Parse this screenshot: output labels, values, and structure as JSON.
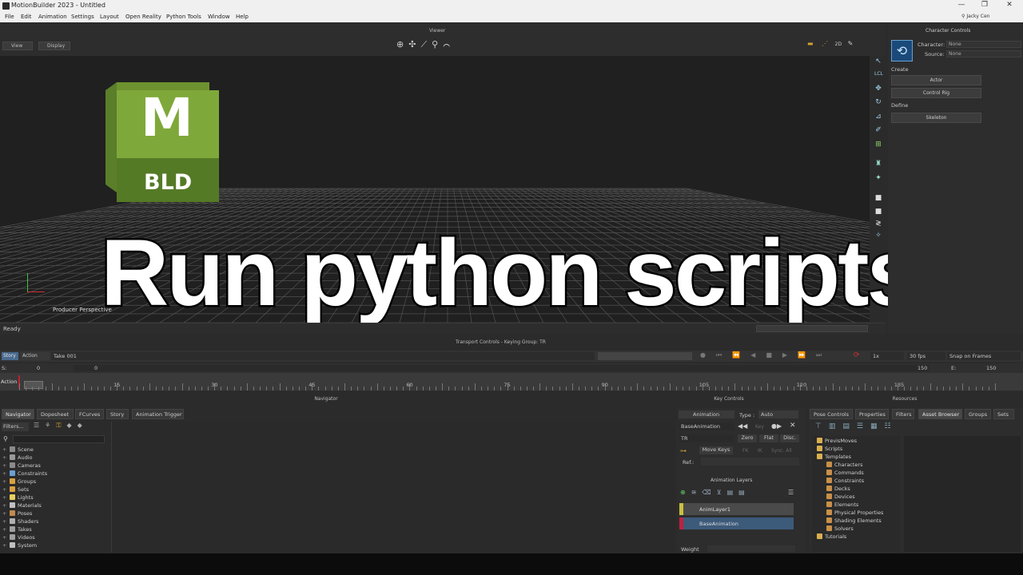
{
  "window": {
    "title": "MotionBuilder 2023 - Untitled",
    "user": "Jacky Cen",
    "controls": [
      "—",
      "❐",
      "✕"
    ]
  },
  "menu": [
    "File",
    "Edit",
    "Animation",
    "Settings",
    "Layout",
    "Open Reality",
    "Python Tools",
    "Window",
    "Help"
  ],
  "viewer": {
    "title": "Viewer",
    "view_btn": "View",
    "display_btn": "Display",
    "camera_label": "Producer Perspective",
    "mode_2d": "2D"
  },
  "logo": {
    "letter": "M",
    "label": "BLD",
    "color_front": "#7fa83a",
    "color_side": "#5a7e2a"
  },
  "headline": "Run python scripts",
  "status": "Ready",
  "character_controls": {
    "title": "Character Controls",
    "character_label": "Character:",
    "character_value": "None",
    "source_label": "Source:",
    "source_value": "None",
    "create_label": "Create",
    "actor_btn": "Actor",
    "control_rig_btn": "Control Rig",
    "define_label": "Define",
    "skeleton_btn": "Skeleton"
  },
  "transport": {
    "title": "Transport Controls  -  Keying Group: TR",
    "story_btn": "Story",
    "action_btn": "Action",
    "take": "Take 001",
    "speed": "1x",
    "fps": "30 fps",
    "snap": "Snap on Frames",
    "start_label": "S:",
    "start_value": "0",
    "current_value": "0",
    "end_value": "150",
    "end_label": "E:",
    "end_value2": "150",
    "track_label": "Action",
    "ruler_labels": [
      "15",
      "30",
      "45",
      "60",
      "75",
      "90",
      "105",
      "120",
      "135"
    ]
  },
  "navigator": {
    "title": "Navigator",
    "tabs": [
      "Navigator",
      "Dopesheet",
      "FCurves",
      "Story",
      "Animation Trigger"
    ],
    "filters": "Filters...",
    "tree": [
      {
        "label": "Scene",
        "color": "#8a8a8a"
      },
      {
        "label": "Audio",
        "color": "#9a9a9a"
      },
      {
        "label": "Cameras",
        "color": "#8a8a8a"
      },
      {
        "label": "Constraints",
        "color": "#6aa0d0"
      },
      {
        "label": "Groups",
        "color": "#d8a040"
      },
      {
        "label": "Sets",
        "color": "#d8a040"
      },
      {
        "label": "Lights",
        "color": "#e8d060"
      },
      {
        "label": "Materials",
        "color": "#c0c0c0"
      },
      {
        "label": "Poses",
        "color": "#c08a50"
      },
      {
        "label": "Shaders",
        "color": "#b0b0b0"
      },
      {
        "label": "Takes",
        "color": "#a0a0a0"
      },
      {
        "label": "Videos",
        "color": "#a0a0a0"
      },
      {
        "label": "System",
        "color": "#c0c0c0"
      }
    ]
  },
  "key_controls": {
    "title": "Key Controls",
    "animation": "Animation",
    "type_label": "Type :",
    "type_value": "Auto",
    "base_animation": "BaseAnimation",
    "key_label": "Key",
    "tr": "TR",
    "zero": "Zero",
    "flat": "Flat",
    "disc": "Disc.",
    "move_keys": "Move Keys",
    "fk": "FK",
    "ik": "IK",
    "sync": "Sync. All",
    "ref": "Ref.:",
    "layers_title": "Animation Layers",
    "layers": [
      {
        "name": "AnimLayer1",
        "color": "#c8c040"
      },
      {
        "name": "BaseAnimation",
        "color": "#c02040"
      }
    ],
    "weight": "Weight"
  },
  "resources": {
    "title": "Resources",
    "tabs": [
      "Pose Controls",
      "Properties",
      "Filters",
      "Asset Browser",
      "Groups",
      "Sets"
    ],
    "tree": [
      "PrevisMoves",
      "Scripts",
      "Templates",
      "Characters",
      "Commands",
      "Constraints",
      "Decks",
      "Devices",
      "Elements",
      "Physical Properties",
      "Shading Elements",
      "Solvers",
      "Tutorials"
    ]
  }
}
